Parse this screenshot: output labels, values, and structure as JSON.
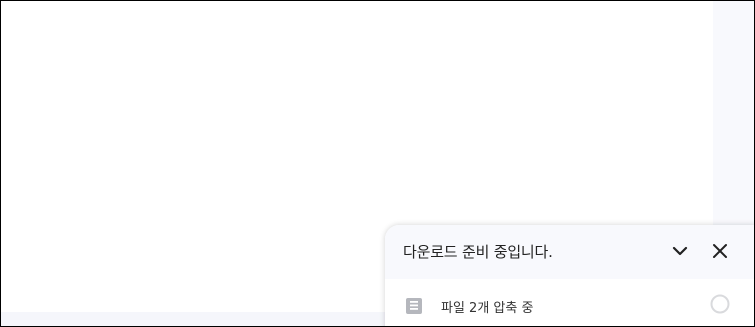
{
  "download_panel": {
    "title": "다운로드 준비 중입니다.",
    "collapse_icon": "chevron-down-icon",
    "close_icon": "close-icon",
    "items": [
      {
        "label": "파일 2개 압축 중",
        "icon": "file-icon",
        "status_icon": "loading-spinner-icon"
      }
    ]
  },
  "colors": {
    "panel_header_bg": "#f8f9fd",
    "side_panel_bg": "#f8f9fd",
    "text": "#222222",
    "file_icon": "#b5b7bd",
    "spinner": "#d9dadd"
  }
}
